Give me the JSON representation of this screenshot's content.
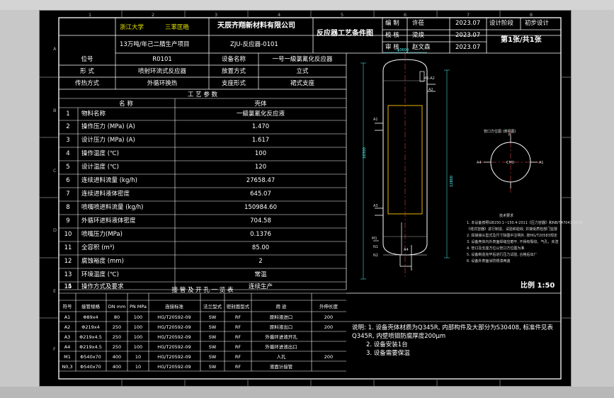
{
  "title_block": {
    "university": "浙江大学",
    "group": "三苯匡晧",
    "company": "天辰齐翔新材料有限公司",
    "project": "13万吨/年己二腈生产项目",
    "drawing_no": "ZJU-反应器-0101",
    "drawing_title": "反应器工艺条件图",
    "roles": [
      "编 制",
      "校 核",
      "审 核"
    ],
    "names": [
      "许莅",
      "梁焌",
      "赵文森"
    ],
    "dates": [
      "2023.07",
      "2023.07",
      "2023.07"
    ],
    "stage_label": "设计阶段",
    "stage_value": "初步设计",
    "sheet": "第1张/共1张"
  },
  "equipment": {
    "tag_label": "位号",
    "tag_value": "R0101",
    "name_label": "设备名称",
    "name_value": "一号一級氯氰化反应器",
    "form_label": "形 式",
    "form_value": "喷射环流式反应器",
    "install_label": "放置方式",
    "install_value": "立式",
    "heat_label": "传热方式",
    "heat_value": "外循环换热",
    "support_label": "支座形式",
    "support_value": "裙式支座"
  },
  "process_params": {
    "header": "工 艺 参 数",
    "col_name": "名 称",
    "col_value": "壳体",
    "rows": [
      {
        "no": "1",
        "name": "物料名称",
        "value": "一級氯氰化反应液"
      },
      {
        "no": "2",
        "name": "操作压力 (MPa) (A)",
        "value": "1.470"
      },
      {
        "no": "3",
        "name": "设计压力 (MPa) (A)",
        "value": "1.617"
      },
      {
        "no": "4",
        "name": "操作温度 (℃)",
        "value": "100"
      },
      {
        "no": "5",
        "name": "设计温度 (℃)",
        "value": "120"
      },
      {
        "no": "6",
        "name": "连续进料流量 (kg/h)",
        "value": "27658.47"
      },
      {
        "no": "7",
        "name": "连续进料液体密度",
        "value": "645.07"
      },
      {
        "no": "8",
        "name": "喷嘴喷进料流量 (kg/h)",
        "value": "150984.60"
      },
      {
        "no": "9",
        "name": "外循环进料液体密度",
        "value": "704.58"
      },
      {
        "no": "10",
        "name": "喷嘴压力(MPa)",
        "value": "0.1376"
      },
      {
        "no": "11",
        "name": "全容积 (m³)",
        "value": "85.00"
      },
      {
        "no": "12",
        "name": "腐蚀裕度 (mm)",
        "value": "2"
      },
      {
        "no": "13",
        "name": "环境温度 (℃)",
        "value": "常温"
      },
      {
        "no": "14",
        "name": "操作方式及要求",
        "value": "连续生产"
      },
      {
        "no": "15",
        "name": "",
        "value": ""
      }
    ]
  },
  "nozzle_table": {
    "header": "接 管 及 开 孔 一 览 表",
    "columns": [
      "符号",
      "接管规格",
      "DN mm",
      "PN MPa",
      "连接标准",
      "法兰型式",
      "密封面型式",
      "用 途",
      "外伸长度"
    ],
    "rows": [
      {
        "sym": "A1",
        "spec": "Φ89x4",
        "dn": "80",
        "pn": "100",
        "std": "HG/T20592-09",
        "flange": "SW",
        "face": "RF",
        "use": "原料液进口",
        "len": "200"
      },
      {
        "sym": "A2",
        "spec": "Φ219x4",
        "dn": "250",
        "pn": "100",
        "std": "HG/T20592-09",
        "flange": "SW",
        "face": "RF",
        "use": "原料液出口",
        "len": "200"
      },
      {
        "sym": "A3",
        "spec": "Φ219x4.5",
        "dn": "250",
        "pn": "100",
        "std": "HG/T20592-09",
        "flange": "SW",
        "face": "RF",
        "use": "外循环进液开孔",
        "len": ""
      },
      {
        "sym": "A4",
        "spec": "Φ219x4.5",
        "dn": "250",
        "pn": "100",
        "std": "HG/T20592-09",
        "flange": "SW",
        "face": "RF",
        "use": "外循环进液出口",
        "len": ""
      },
      {
        "sym": "M1",
        "spec": "Φ540x70",
        "dn": "400",
        "pn": "10",
        "std": "HG/T20592-09",
        "flange": "SW",
        "face": "RF",
        "use": "人孔",
        "len": "200"
      },
      {
        "sym": "N0,3",
        "spec": "Φ540x70",
        "dn": "400",
        "pn": "10",
        "std": "HG/T20592-09",
        "flange": "SW",
        "face": "RF",
        "use": "液面计接管",
        "len": ""
      }
    ]
  },
  "notes": {
    "lines": [
      "说明: 1. 设备壳体材质为Q345R, 内部构件及大部分为S30408, 标准件见表",
      "Q345R, 内壁喷钼防腐厚度200μm",
      "2. 设备安装1台",
      "3. 设备需要保温"
    ]
  },
  "drawing": {
    "scale": "比例 1:50",
    "dim_height": "16300",
    "dim_diameter": "φ3600",
    "dim_shell": "12800",
    "manway": "M1-A2",
    "view_label": "管口方位图 (俯视图)",
    "orient_center": "CM0",
    "orient_n": "N",
    "orient_a": "A1",
    "orient_a4": "A4",
    "tech_title": "技术要求",
    "tech_lines": [
      "1. 本设备按照GB150.1~150.4-2011《压力容器》和NB/T47041-2014",
      "《塔式容器》进行制造、试验和验收, 并接受质检部门监督",
      "2. 焊接接头型式及尺寸除图中注明外, 按HG/T20583规定",
      "3. 设备壳体内外表面焊缝应磨平, 不得有裂纹、气孔、夹渣",
      "4. 管口及支座方位以管口方位图为准",
      "5. 设备制造完毕后进行压力试验, 合格后出厂",
      "6. 设备外表面涂防锈漆两遍"
    ],
    "nozzle_tags": [
      "A1",
      "A2",
      "A3",
      "A4",
      "M1",
      "N1",
      "N2"
    ]
  },
  "border": {
    "top_numbers": [
      "1",
      "2",
      "3",
      "4",
      "5",
      "6",
      "7",
      "8"
    ],
    "side_letters": [
      "A",
      "B",
      "C",
      "D",
      "E",
      "F"
    ]
  }
}
